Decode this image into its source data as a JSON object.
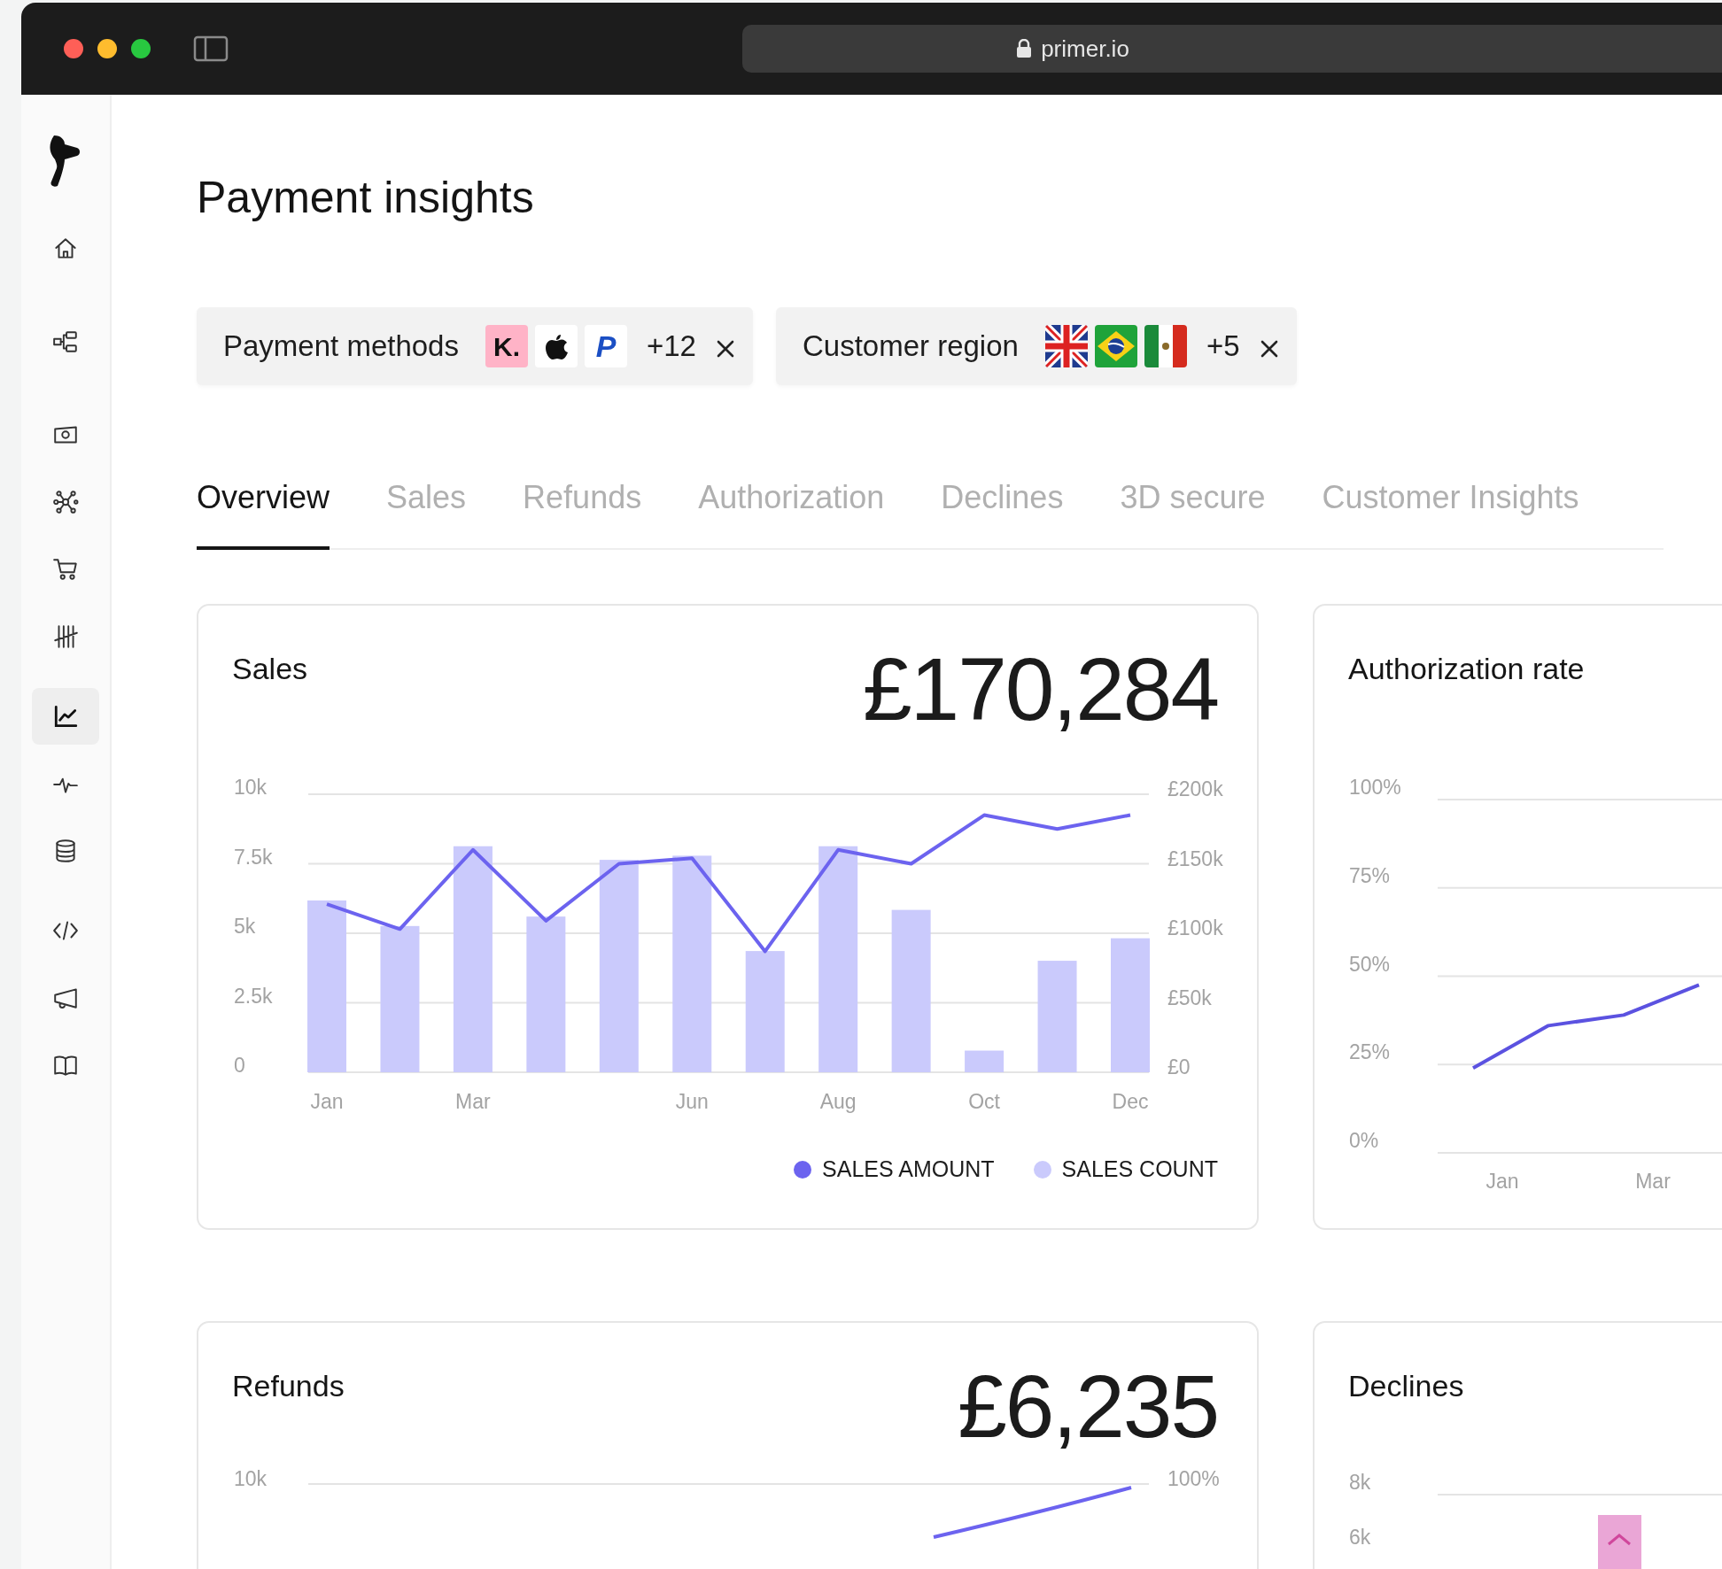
{
  "browser": {
    "url": "primer.io"
  },
  "sidebar": {
    "items": [
      {
        "kind": "home",
        "selected": false
      },
      {
        "kind": "flow",
        "selected": false
      },
      {
        "kind": "cash",
        "selected": false
      },
      {
        "kind": "network",
        "selected": false
      },
      {
        "kind": "cart",
        "selected": false
      },
      {
        "kind": "tally",
        "selected": false
      },
      {
        "kind": "chart",
        "selected": true
      },
      {
        "kind": "pulse",
        "selected": false
      },
      {
        "kind": "database",
        "selected": false
      },
      {
        "kind": "code",
        "selected": false
      },
      {
        "kind": "megaphone",
        "selected": false
      },
      {
        "kind": "book",
        "selected": false
      }
    ]
  },
  "page_title": "Payment insights",
  "filters": [
    {
      "label": "Payment methods",
      "badges": [
        {
          "kind": "klarna",
          "text": "K."
        },
        {
          "kind": "apple"
        },
        {
          "kind": "paypal",
          "text": "P"
        }
      ],
      "more": "+12"
    },
    {
      "label": "Customer region",
      "badges": [
        {
          "kind": "flag-uk"
        },
        {
          "kind": "flag-brazil"
        },
        {
          "kind": "flag-mexico"
        }
      ],
      "more": "+5"
    }
  ],
  "tabs": [
    {
      "label": "Overview",
      "selected": true
    },
    {
      "label": "Sales",
      "selected": false
    },
    {
      "label": "Refunds",
      "selected": false
    },
    {
      "label": "Authorization",
      "selected": false
    },
    {
      "label": "Declines",
      "selected": false
    },
    {
      "label": "3D secure",
      "selected": false
    },
    {
      "label": "Customer Insights",
      "selected": false
    }
  ],
  "sales_card": {
    "title": "Sales",
    "total": "£170,284",
    "chart_data": {
      "type": "bar",
      "grid": true,
      "categories": [
        "Jan",
        null,
        "Mar",
        null,
        null,
        "Jun",
        null,
        "Aug",
        null,
        "Oct",
        null,
        "Dec"
      ],
      "ylim": [
        0,
        10000
      ],
      "yticks": [
        {
          "value": 0,
          "label": "0"
        },
        {
          "value": 2500,
          "label": "2.5k"
        },
        {
          "value": 5000,
          "label": "5k"
        },
        {
          "value": 7500,
          "label": "7.5k"
        },
        {
          "value": 10000,
          "label": "10k"
        }
      ],
      "y2lim": [
        0,
        200000
      ],
      "y2ticks": [
        {
          "value": 0,
          "label": "£0"
        },
        {
          "value": 50000,
          "label": "£50k"
        },
        {
          "value": 100000,
          "label": "£100k"
        },
        {
          "value": 150000,
          "label": "£150k"
        },
        {
          "value": 200000,
          "label": "£200k"
        }
      ],
      "series": [
        {
          "name": "SALES AMOUNT",
          "type": "line",
          "axis": "y2",
          "color": "#6c63ef",
          "values": [
            121000,
            103000,
            160000,
            109000,
            150000,
            154000,
            87000,
            160000,
            150000,
            185000,
            175000,
            185000
          ]
        },
        {
          "name": "SALES COUNT",
          "type": "bar",
          "color": "#cacafc",
          "values": [
            6180,
            5260,
            8130,
            5600,
            7640,
            7790,
            4360,
            8130,
            5840,
            780,
            4010,
            4820
          ]
        }
      ]
    }
  },
  "authorization_card": {
    "title": "Authorization rate",
    "chart_data": {
      "type": "line",
      "grid": true,
      "categories": [
        "Jan",
        null,
        "Mar",
        null
      ],
      "ylim": [
        0,
        100
      ],
      "yticks": [
        {
          "value": 0,
          "label": "0%"
        },
        {
          "value": 25,
          "label": "25%"
        },
        {
          "value": 50,
          "label": "50%"
        },
        {
          "value": 75,
          "label": "75%"
        },
        {
          "value": 100,
          "label": "100%"
        }
      ],
      "series": [
        {
          "color": "#5b52e0",
          "values": [
            24,
            36,
            39,
            47.5
          ]
        }
      ]
    }
  },
  "refunds_card": {
    "title": "Refunds",
    "total": "£6,235",
    "left_axis_labels": [
      "10k"
    ],
    "right_axis_labels": [
      "100%"
    ]
  },
  "declines_card": {
    "title": "Declines",
    "axis_labels": [
      "8k",
      "6k"
    ]
  }
}
